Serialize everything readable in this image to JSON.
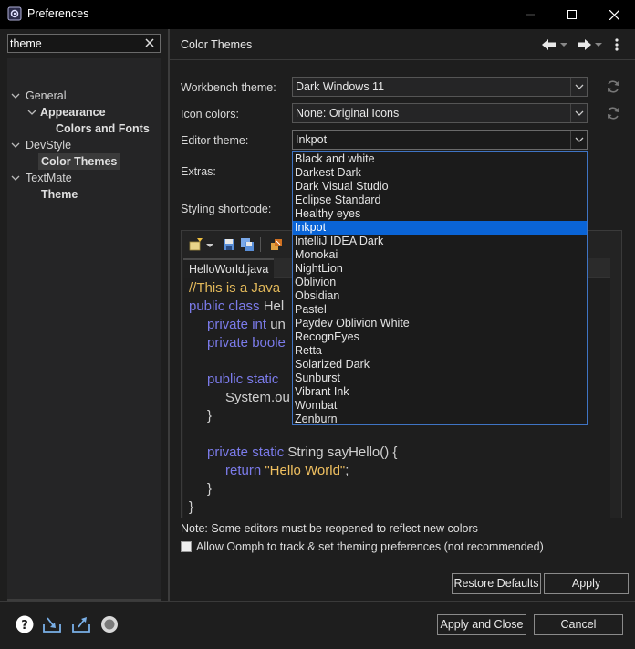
{
  "window": {
    "title": "Preferences"
  },
  "filter": {
    "value": "theme"
  },
  "tree": {
    "items": [
      {
        "label": "General"
      },
      {
        "label": "Appearance"
      },
      {
        "label": "Colors and Fonts"
      },
      {
        "label": "DevStyle"
      },
      {
        "label": "Color Themes"
      },
      {
        "label": "TextMate"
      },
      {
        "label": "Theme"
      }
    ]
  },
  "page": {
    "title": "Color Themes",
    "workbench_theme_label": "Workbench theme:",
    "workbench_theme_value": "Dark Windows 11",
    "icon_colors_label": "Icon colors:",
    "icon_colors_value": "None: Original Icons",
    "editor_theme_label": "Editor theme:",
    "editor_theme_value": "Inkpot",
    "extras_label": "Extras:",
    "styling_shortcode_label": "Styling shortcode:"
  },
  "preview": {
    "tab_label": "HelloWorld.java",
    "code": {
      "line1": "//This is a Java",
      "line2_kw": "public class ",
      "line2_rest": "Hel",
      "line3_kw": "private int ",
      "line3_rest": "un",
      "line4_kw": "private boole",
      "line6_kw": "public static",
      "line7": "System.ou",
      "line8": "}",
      "line10_kw": "private static ",
      "line10_rest": "String sayHello() {",
      "line11_kw": "return ",
      "line11_str": "\"Hello World\"",
      "line11_end": ";",
      "line12": "}",
      "line13": "}"
    }
  },
  "dropdown": {
    "options": [
      "Black and white",
      "Darkest Dark",
      "Dark Visual Studio",
      "Eclipse Standard",
      "Healthy eyes",
      "Inkpot",
      "IntelliJ IDEA Dark",
      "Monokai",
      "NightLion",
      "Oblivion",
      "Obsidian",
      "Pastel",
      "Paydev Oblivion White",
      "RecognEyes",
      "Retta",
      "Solarized Dark",
      "Sunburst",
      "Vibrant Ink",
      "Wombat",
      "Zenburn"
    ],
    "selected": "Inkpot"
  },
  "note": "Note: Some editors must be reopened to reflect new colors",
  "oomph_checkbox": {
    "label": "Allow Oomph to track & set theming preferences (not recommended)",
    "checked": false
  },
  "buttons": {
    "restore_defaults": "Restore Defaults",
    "apply": "Apply",
    "apply_and_close": "Apply and Close",
    "cancel": "Cancel"
  },
  "colors": {
    "background": "#1e1e1e",
    "selection": "#0a64d6",
    "dropdown_border": "#3f74c4"
  }
}
